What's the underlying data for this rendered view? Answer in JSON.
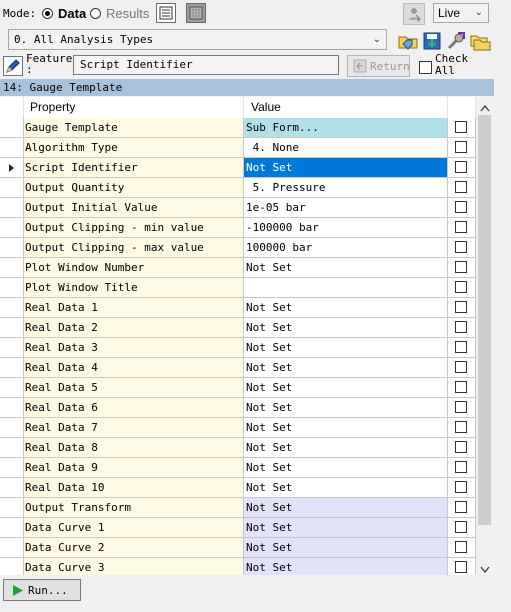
{
  "toolbar": {
    "mode_label": "Mode:",
    "modes": [
      {
        "label": "Data",
        "selected": true
      },
      {
        "label": "Results",
        "selected": false
      }
    ],
    "live_select": "Live",
    "analysis_select": "0. All Analysis Types"
  },
  "feature": {
    "label_line1": "Feature",
    "label_line2": ":",
    "value": "Script Identifier",
    "return_label": "Return",
    "check_all_line1": "Check",
    "check_all_line2": "All"
  },
  "section": {
    "title": "14: Gauge Template"
  },
  "grid": {
    "headers": {
      "property": "Property",
      "value": "Value"
    },
    "rows": [
      {
        "property": "Gauge Template",
        "value": "Sub Form...",
        "kind": "subform"
      },
      {
        "property": "Algorithm Type",
        "value": " 4. None",
        "kind": "plain"
      },
      {
        "property": "Script Identifier",
        "value": "Not Set",
        "kind": "selected"
      },
      {
        "property": "Output Quantity",
        "value": " 5. Pressure",
        "kind": "plain"
      },
      {
        "property": "Output Initial Value",
        "value": "1e-05 bar",
        "kind": "plain"
      },
      {
        "property": "Output Clipping - min value",
        "value": "-100000 bar",
        "kind": "plain"
      },
      {
        "property": "Output Clipping - max value",
        "value": "100000 bar",
        "kind": "plain"
      },
      {
        "property": "Plot Window Number",
        "value": "Not Set",
        "kind": "plain"
      },
      {
        "property": "Plot Window Title",
        "value": "",
        "kind": "plain"
      },
      {
        "property": "Real Data  1",
        "value": "Not Set",
        "kind": "plain"
      },
      {
        "property": "Real Data  2",
        "value": "Not Set",
        "kind": "plain"
      },
      {
        "property": "Real Data  3",
        "value": "Not Set",
        "kind": "plain"
      },
      {
        "property": "Real Data  4",
        "value": "Not Set",
        "kind": "plain"
      },
      {
        "property": "Real Data  5",
        "value": "Not Set",
        "kind": "plain"
      },
      {
        "property": "Real Data  6",
        "value": "Not Set",
        "kind": "plain"
      },
      {
        "property": "Real Data  7",
        "value": "Not Set",
        "kind": "plain"
      },
      {
        "property": "Real Data  8",
        "value": "Not Set",
        "kind": "plain"
      },
      {
        "property": "Real Data  9",
        "value": "Not Set",
        "kind": "plain"
      },
      {
        "property": "Real Data  10",
        "value": "Not Set",
        "kind": "plain"
      },
      {
        "property": "Output Transform",
        "value": "Not Set",
        "kind": "lav"
      },
      {
        "property": "Data Curve 1",
        "value": "Not Set",
        "kind": "lav"
      },
      {
        "property": "Data Curve 2",
        "value": "Not Set",
        "kind": "lav"
      },
      {
        "property": "Data Curve 3",
        "value": "Not Set",
        "kind": "lav"
      }
    ]
  },
  "bottom": {
    "run_label": "Run..."
  },
  "colors": {
    "property_bg": "#fdf9e3",
    "subform_bg": "#b2e0e8",
    "selected_bg": "#0078d7",
    "lavender_bg": "#e2e2f8",
    "section_bg": "#a8c2de"
  },
  "icons": {
    "toolbar": [
      "grid-view-icon",
      "texture-view-icon",
      "user-cursor-icon",
      "folder-tag-icon",
      "save-down-icon",
      "wrench-icon",
      "folder-stack-icon"
    ],
    "feature": [
      "pencil-icon",
      "return-arrow-icon"
    ],
    "run": "play-icon"
  }
}
